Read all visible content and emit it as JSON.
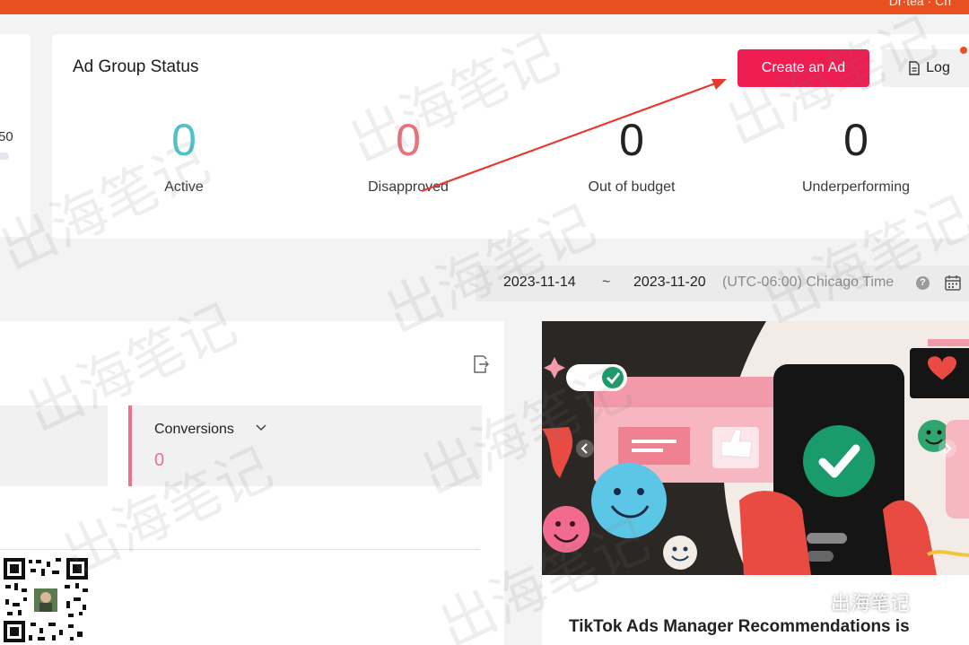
{
  "topbar": {
    "text": "Dr·tea · Ch"
  },
  "left_card": {
    "edge_number": "50"
  },
  "status": {
    "title": "Ad Group Status",
    "create_label": "Create an Ad",
    "log_label": "Log",
    "metrics": [
      {
        "value": "0",
        "label": "Active",
        "color": "#4fc3c9"
      },
      {
        "value": "0",
        "label": "Disapproved",
        "color": "#e7737c"
      },
      {
        "value": "0",
        "label": "Out of budget",
        "color": "#222222"
      },
      {
        "value": "0",
        "label": "Underperforming",
        "color": "#222222"
      }
    ]
  },
  "date_range": {
    "start": "2023-11-14",
    "separator": "~",
    "end": "2023-11-20",
    "timezone": "(UTC-06:00) Chicago Time"
  },
  "metrics_panel": {
    "conversions_label": "Conversions",
    "conversions_value": "0"
  },
  "promo": {
    "title": "TikTok Ads Manager Recommendations is"
  },
  "watermark": {
    "text": "出海笔记",
    "badge_text": "出海笔记"
  },
  "colors": {
    "brand_orange": "#e8501f",
    "primary_pink": "#ee1d52"
  }
}
